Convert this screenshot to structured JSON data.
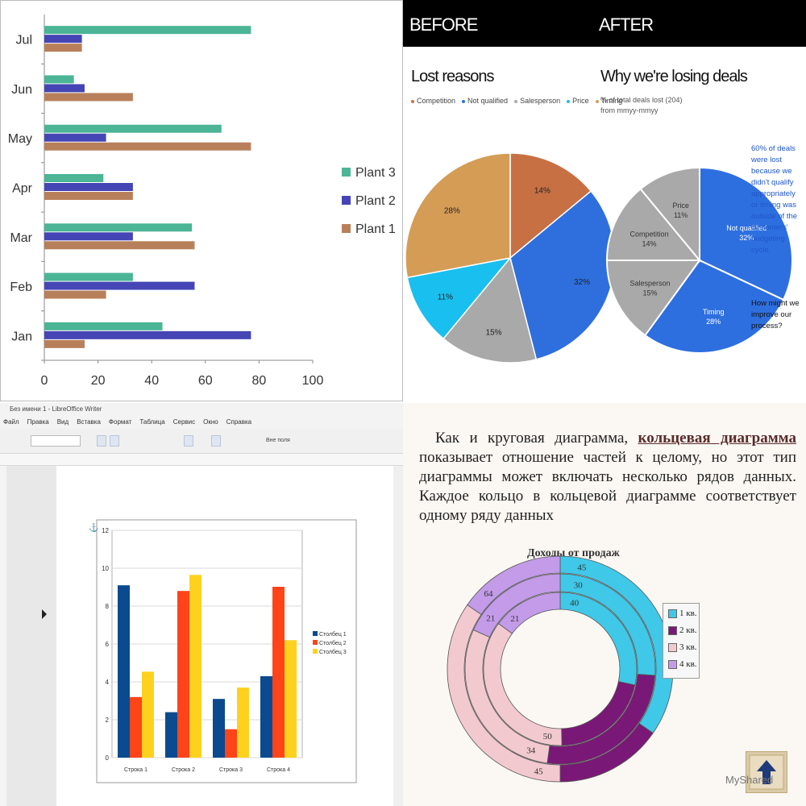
{
  "panel_bar": {
    "chart_data": {
      "type": "bar",
      "orientation": "horizontal",
      "categories": [
        "Jan",
        "Feb",
        "Mar",
        "Apr",
        "May",
        "Jun",
        "Jul"
      ],
      "series": [
        {
          "name": "Plant 1",
          "color": "#b8805a",
          "values": [
            15,
            23,
            56,
            33,
            77,
            33,
            14
          ]
        },
        {
          "name": "Plant 2",
          "color": "#4545b5",
          "values": [
            77,
            56,
            33,
            33,
            23,
            15,
            14
          ]
        },
        {
          "name": "Plant 3",
          "color": "#4bb596",
          "values": [
            44,
            33,
            55,
            22,
            66,
            11,
            77
          ]
        }
      ],
      "xlim": [
        0,
        100
      ],
      "xticks": [
        "0",
        "20",
        "40",
        "60",
        "80",
        "100"
      ],
      "legend_position": "right"
    }
  },
  "panel_pies": {
    "header_before": "BEFORE",
    "header_after": "AFTER",
    "before": {
      "title": "Lost reasons",
      "legend": [
        "Competition",
        "Not qualified",
        "Salesperson",
        "Price",
        "Timing"
      ],
      "legend_colors": [
        "#c77044",
        "#2f6fdd",
        "#a9a9a9",
        "#19bfee",
        "#d59c55"
      ],
      "chart_data": {
        "type": "pie",
        "labels": [
          "Competition",
          "Not qualified",
          "Salesperson",
          "Price",
          "Timing"
        ],
        "values": [
          14,
          32,
          15,
          11,
          28
        ],
        "value_labels": [
          "14%",
          "32%",
          "15%",
          "11%",
          "28%"
        ]
      }
    },
    "after": {
      "title": "Why we're losing deals",
      "subtitle": "% of total deals lost (204)",
      "subtitle2": "from mmyy-mmyy",
      "note": "60% of deals were lost because we didn't qualify appropriately or timing was outside of the customers' budgeting cycle.",
      "question": "How might we improve our process?",
      "chart_data": {
        "type": "pie",
        "labels": [
          "Not qualified",
          "Timing",
          "Salesperson",
          "Competition",
          "Price"
        ],
        "values": [
          32,
          28,
          15,
          14,
          11
        ],
        "value_labels": [
          "Not qualified 32%",
          "Timing 28%",
          "Salesperson 15%",
          "Competition 14%",
          "Price 11%"
        ]
      }
    }
  },
  "panel_writer": {
    "window_title": "Без имени 1 - LibreOffice Writer",
    "menu": [
      "Файл",
      "Правка",
      "Вид",
      "Вставка",
      "Формат",
      "Таблица",
      "Сервис",
      "Окно",
      "Справка"
    ],
    "toolbar_label": "Вне поля",
    "chart_data": {
      "type": "bar",
      "categories": [
        "Строка 1",
        "Строка 2",
        "Строка 3",
        "Строка 4"
      ],
      "series": [
        {
          "name": "Столбец 1",
          "color": "#0b4a8f",
          "values": [
            9.1,
            2.4,
            3.1,
            4.3
          ]
        },
        {
          "name": "Столбец 2",
          "color": "#ff4419",
          "values": [
            3.2,
            8.8,
            1.5,
            9.02
          ]
        },
        {
          "name": "Столбец 3",
          "color": "#ffd11f",
          "values": [
            4.54,
            9.65,
            3.7,
            6.2
          ]
        }
      ],
      "ylim": [
        0,
        12
      ],
      "yticks": [
        "0",
        "2",
        "4",
        "6",
        "8",
        "10",
        "12"
      ],
      "legend_position": "right"
    }
  },
  "panel_doughnut": {
    "paragraph_before": "Как и круговая диаграмма, ",
    "paragraph_link": "кольцевая диаграмма",
    "paragraph_after": " показывает отношение частей к целому, но этот тип диаграммы может включать несколько рядов данных. Каждое кольцо в кольцевой диаграмме соответствует одному ряду данных",
    "chart_data": {
      "type": "doughnut",
      "title": "Доходы от продаж",
      "categories": [
        "1 кв.",
        "2 кв.",
        "3 кв.",
        "4 кв."
      ],
      "colors": [
        "#3fc8e8",
        "#7a1877",
        "#f3c9d0",
        "#c39be8"
      ],
      "rings": [
        {
          "values": [
            45,
            20,
            45,
            20
          ],
          "labels": [
            "45",
            "",
            "45",
            "64"
          ]
        },
        {
          "values": [
            30,
            30,
            34,
            21
          ],
          "labels": [
            "30",
            "",
            "34",
            "21"
          ]
        },
        {
          "values": [
            40,
            30,
            50,
            21
          ],
          "labels": [
            "40",
            "",
            "50",
            "21"
          ]
        }
      ],
      "legend_position": "right"
    },
    "logo_text": "MyShared"
  }
}
